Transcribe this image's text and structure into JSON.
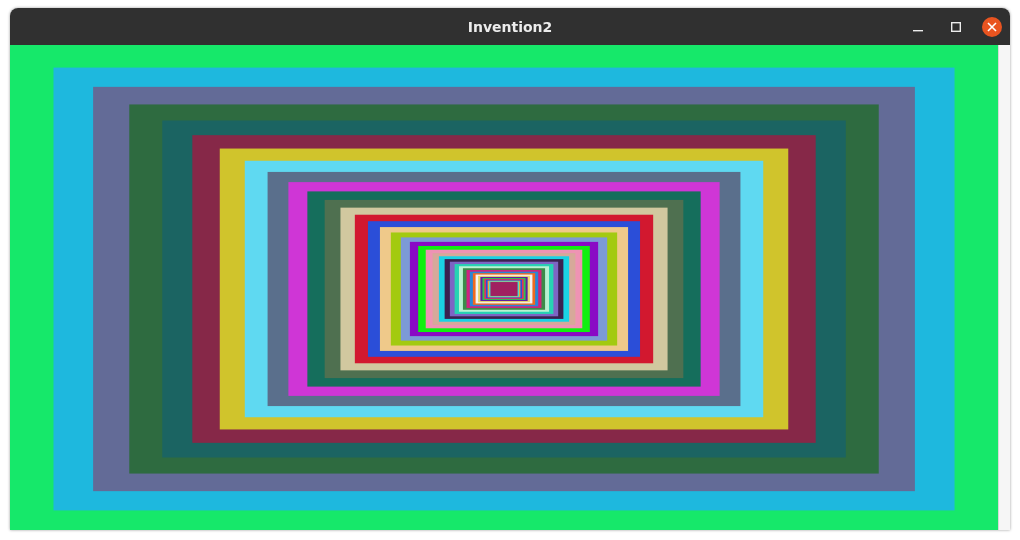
{
  "window": {
    "title": "Invention2"
  }
}
